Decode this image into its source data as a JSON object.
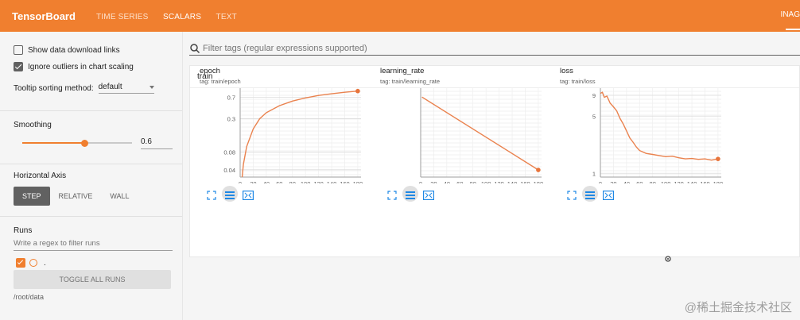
{
  "header": {
    "brand": "TensorBoard",
    "nav": [
      "TIME SERIES",
      "SCALARS",
      "TEXT"
    ],
    "active_nav": "SCALARS",
    "right_tab": "INAG"
  },
  "sidebar": {
    "show_download_links": "Show data download links",
    "ignore_outliers": "Ignore outliers in chart scaling",
    "tooltip_label": "Tooltip sorting method:",
    "tooltip_value": "default",
    "smoothing_label": "Smoothing",
    "smoothing_value": "0.6",
    "smoothing_fraction": 0.6,
    "horizontal_axis_label": "Horizontal Axis",
    "axis_options": [
      "STEP",
      "RELATIVE",
      "WALL"
    ],
    "axis_active": "STEP",
    "runs_label": "Runs",
    "runs_placeholder": "Write a regex to filter runs",
    "run_name": ".",
    "toggle_all": "TOGGLE ALL RUNS",
    "logdir": "/root/data"
  },
  "main": {
    "filter_placeholder": "Filter tags (regular expressions supported)",
    "group_name": "train"
  },
  "colors": {
    "accent": "#f07f2f",
    "series": "#e8743b"
  },
  "chart_data": [
    {
      "type": "line",
      "title": "epoch",
      "tag": "tag: train/epoch",
      "x_ticks": [
        0,
        20,
        40,
        60,
        80,
        100,
        120,
        140,
        160,
        180
      ],
      "y_ticks": [
        "0.7",
        "0.3",
        "0.08",
        "0.04"
      ],
      "y_scale": "log",
      "xlim": [
        0,
        185
      ],
      "ylim": [
        0.03,
        1
      ],
      "x": [
        3,
        5,
        10,
        20,
        30,
        40,
        60,
        80,
        100,
        120,
        140,
        160,
        180
      ],
      "y": [
        0.03,
        0.05,
        0.1,
        0.2,
        0.3,
        0.38,
        0.5,
        0.6,
        0.68,
        0.75,
        0.8,
        0.85,
        0.89
      ]
    },
    {
      "type": "line",
      "title": "learning_rate",
      "tag": "tag: train/learning_rate",
      "x_ticks": [
        0,
        20,
        40,
        60,
        80,
        100,
        120,
        140,
        160,
        180
      ],
      "y_ticks": [],
      "y_scale": "linear",
      "xlim": [
        0,
        185
      ],
      "ylim": [
        0,
        1
      ],
      "x": [
        2,
        180
      ],
      "y": [
        0.9,
        0.08
      ]
    },
    {
      "type": "line",
      "title": "loss",
      "tag": "tag: train/loss",
      "x_ticks": [
        0,
        20,
        40,
        60,
        80,
        100,
        120,
        140,
        160,
        180
      ],
      "y_ticks": [
        "9",
        "5",
        "1"
      ],
      "y_scale": "log",
      "xlim": [
        0,
        185
      ],
      "ylim": [
        0.9,
        11
      ],
      "x": [
        0,
        3,
        6,
        10,
        15,
        20,
        25,
        30,
        35,
        40,
        45,
        50,
        55,
        60,
        70,
        80,
        90,
        100,
        110,
        120,
        130,
        140,
        150,
        160,
        170,
        180
      ],
      "y": [
        9.5,
        9.8,
        8.5,
        8.8,
        7.2,
        6.5,
        5.8,
        4.7,
        4.0,
        3.3,
        2.7,
        2.4,
        2.1,
        1.9,
        1.75,
        1.7,
        1.65,
        1.6,
        1.62,
        1.55,
        1.5,
        1.52,
        1.48,
        1.5,
        1.45,
        1.5
      ]
    }
  ],
  "watermark": "@稀土掘金技术社区"
}
